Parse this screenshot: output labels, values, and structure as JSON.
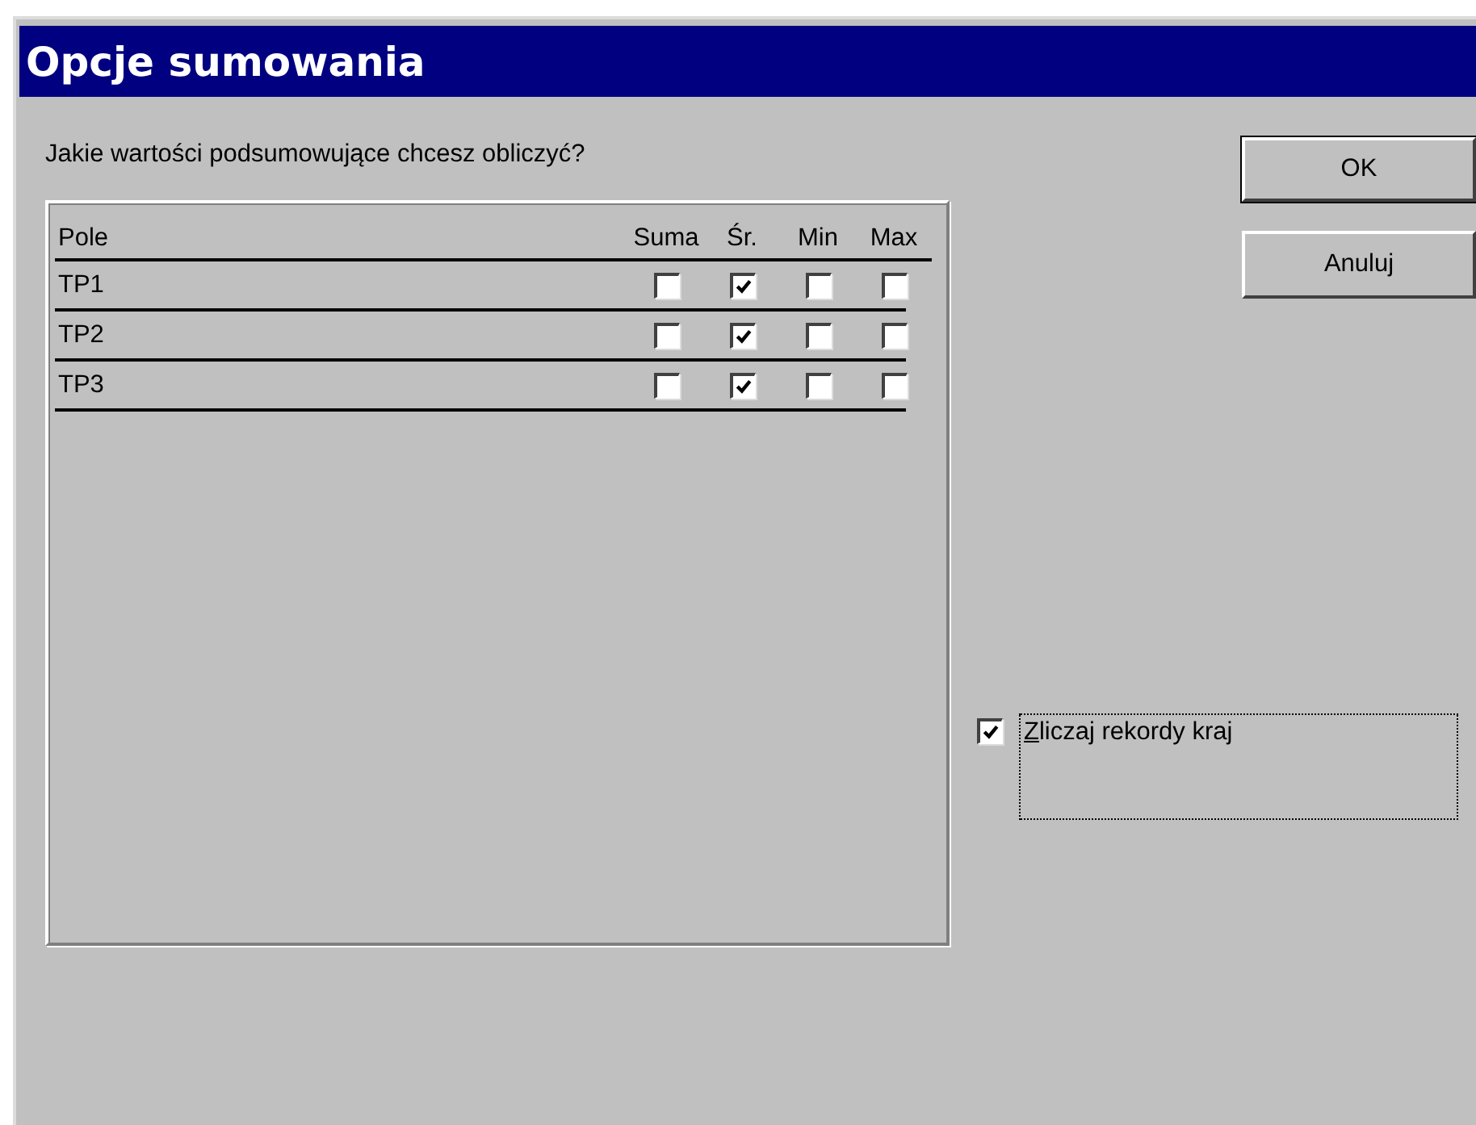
{
  "window": {
    "title": "Opcje sumowania"
  },
  "prompt": "Jakie wartości podsumowujące chcesz obliczyć?",
  "table": {
    "columns": [
      "Pole",
      "Suma",
      "Śr.",
      "Min",
      "Max"
    ],
    "rows": [
      {
        "field": "TP1",
        "checks": [
          false,
          true,
          false,
          false
        ]
      },
      {
        "field": "TP2",
        "checks": [
          false,
          true,
          false,
          false
        ]
      },
      {
        "field": "TP3",
        "checks": [
          false,
          true,
          false,
          false
        ]
      }
    ]
  },
  "buttons": [
    {
      "label": "OK",
      "default": true
    },
    {
      "label": "Anuluj",
      "default": false
    }
  ],
  "count_option": {
    "label": "Zliczaj rekordy kraj",
    "checked": true,
    "focused": true
  }
}
